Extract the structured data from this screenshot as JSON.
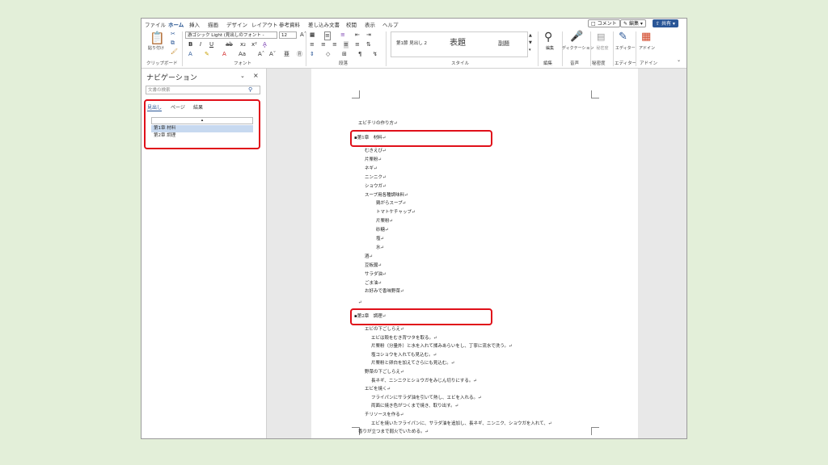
{
  "tabs": [
    "ファイル",
    "ホーム",
    "挿入",
    "描画",
    "デザイン",
    "レイアウト",
    "参考資料",
    "差し込み文書",
    "校閲",
    "表示",
    "ヘルプ"
  ],
  "active_tab": "ホーム",
  "header_buttons": {
    "comment": "コメント",
    "edit": "編集",
    "share": "共有"
  },
  "ribbon": {
    "clipboard": {
      "paste": "貼り付け",
      "label": "クリップボード"
    },
    "font": {
      "name": "游ゴシック Light (見出しのフォント -",
      "size": "12",
      "label": "フォント"
    },
    "paragraph": {
      "label": "段落"
    },
    "styles": {
      "items": [
        "第1節  見出し 2",
        "表題",
        "副題"
      ],
      "label": "スタイル"
    },
    "editing": {
      "label": "編集"
    },
    "voice": {
      "dictate": "ディクテーション",
      "label": "音声"
    },
    "sensitivity": {
      "btn": "秘密度",
      "label": "秘密度"
    },
    "editor": {
      "btn": "エディター",
      "label": "エディター"
    },
    "addins": {
      "btn": "アドイン",
      "label": "アドイン"
    }
  },
  "nav": {
    "title": "ナビゲーション",
    "search_placeholder": "文書の検索",
    "tabs": [
      "見出し",
      "ページ",
      "結果"
    ],
    "items": [
      "第1章 材料",
      "第2章 調理"
    ]
  },
  "doc": {
    "title": "エビチリの作り方",
    "h1": "第1章　材料",
    "list1": [
      "むきえび",
      "片栗粉",
      "ネギ",
      "ニンニク",
      "ショウガ",
      "スープ用各種調味料"
    ],
    "list1_sub": [
      "鶏がらスープ",
      "トマトケチャップ",
      "片栗粉",
      "砂糖",
      "塩",
      "水"
    ],
    "list2": [
      "酒",
      "豆板醤",
      "サラダ油",
      "ごま油",
      "お好みで香味野菜"
    ],
    "h2": "第2章　調理",
    "steps": [
      {
        "t": "エビの下ごしらえ",
        "i": 1
      },
      {
        "t": "エビは殻をむき背ワタを取る。",
        "i": 2
      },
      {
        "t": "片栗粉（分量外）と水を入れて揉みあらいをし、丁寧に流水で洗う。",
        "i": 2
      },
      {
        "t": "塩コショウを入れても見込む。",
        "i": 2
      },
      {
        "t": "片栗粉と卵白を加えてさらにも見込む。",
        "i": 2
      },
      {
        "t": "野菜の下ごしらえ",
        "i": 1
      },
      {
        "t": "長ネギ、ニンニクとショウガをみじん切りにする。",
        "i": 2
      },
      {
        "t": "エビを焼く",
        "i": 1
      },
      {
        "t": "フライパンにサラダ油を引いて熱し、エビを入れる。",
        "i": 2
      },
      {
        "t": "両面に焼き色がつくまで焼き、取り出す。",
        "i": 2
      },
      {
        "t": "チリソースを作る",
        "i": 1
      },
      {
        "t": "エビを焼いたフライパンに、サラダ油を追加し、長ネギ、ニンニク、ショウガを入れて、",
        "i": 2
      },
      {
        "t": "香りが立つまで弱火でいためる。",
        "i": 0
      }
    ]
  },
  "colors": {
    "highlight": "#e0101a",
    "accent": "#2b5797",
    "background": "#e3efd9"
  }
}
